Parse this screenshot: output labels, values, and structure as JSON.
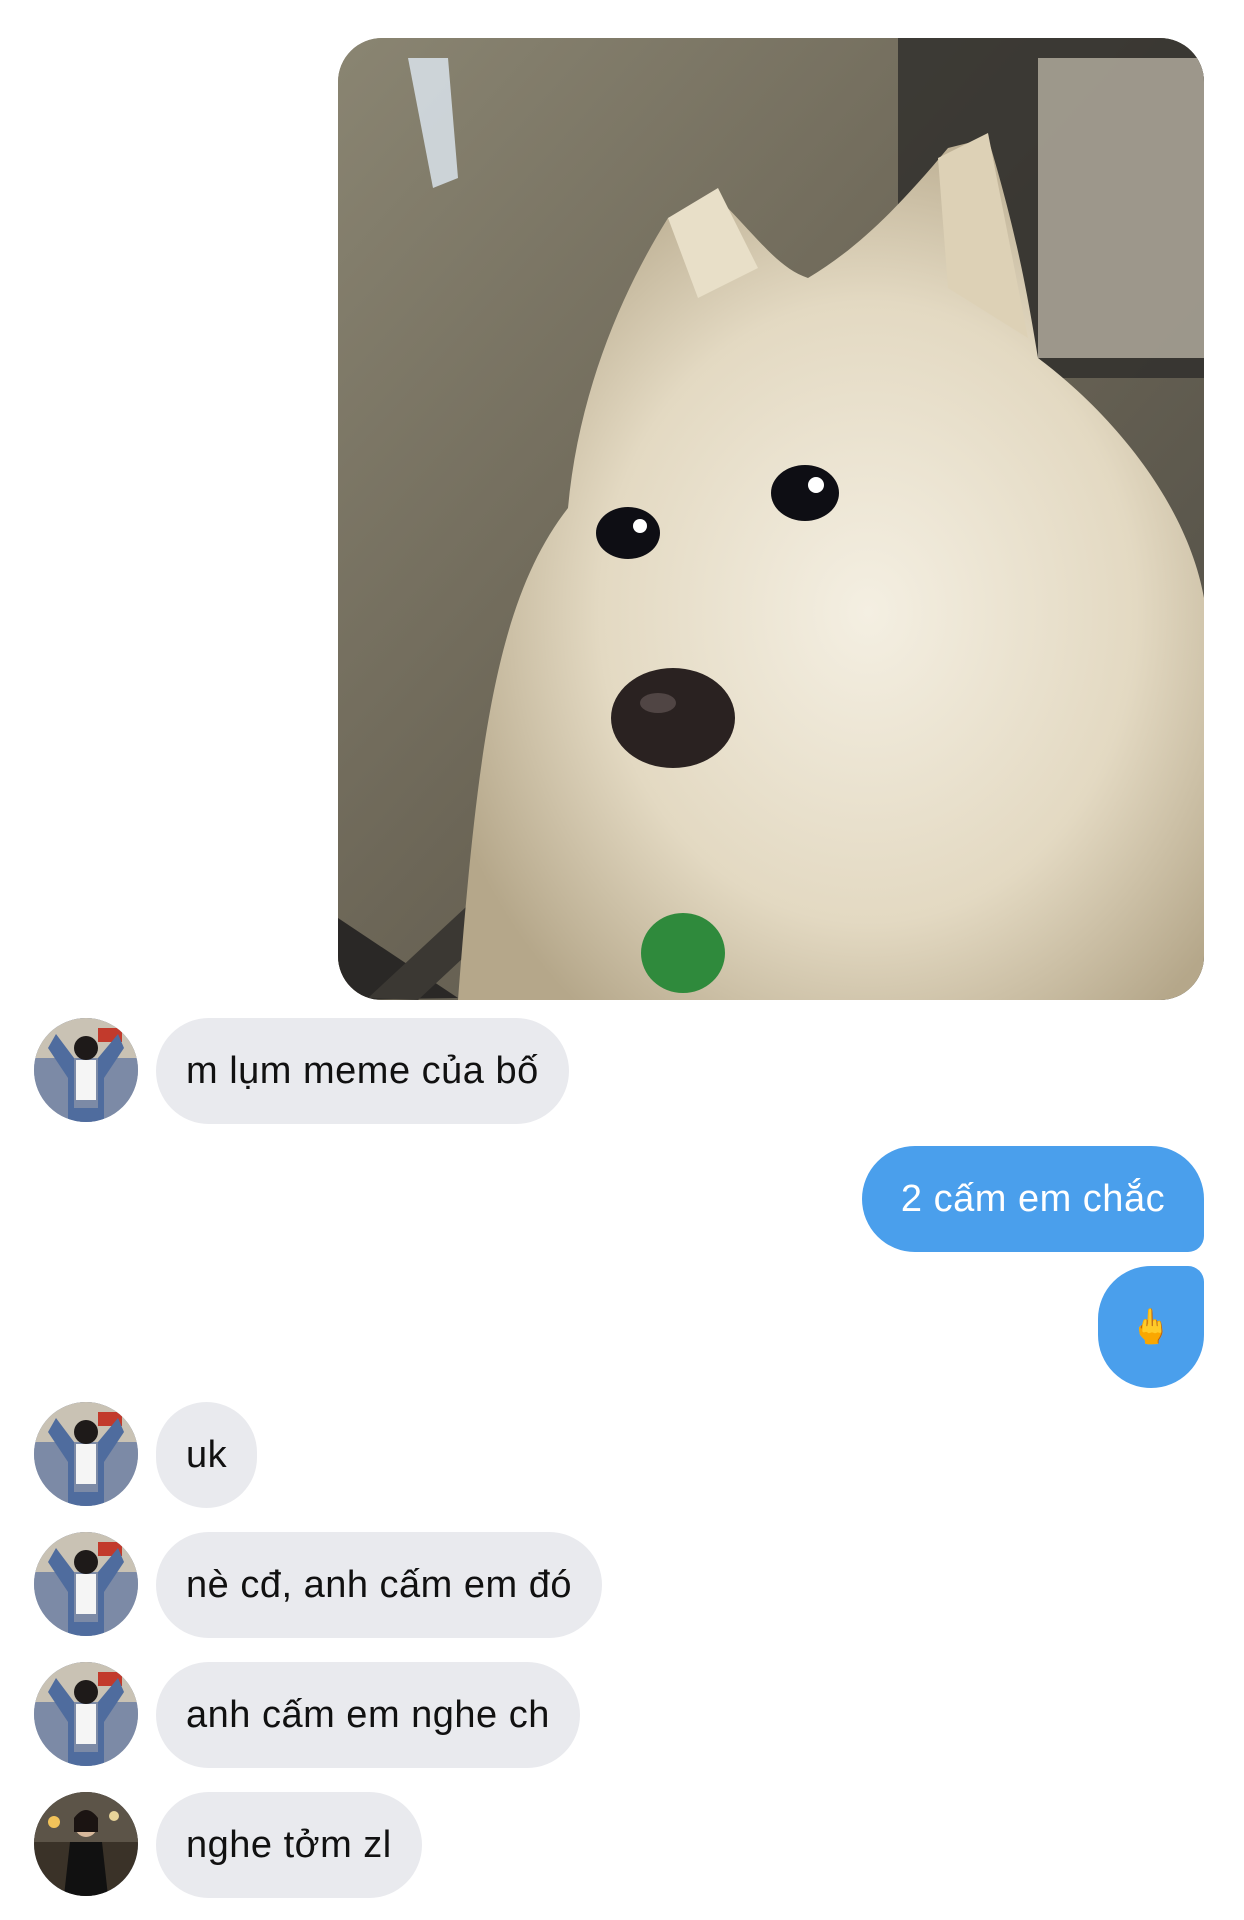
{
  "conversation": {
    "shared_image": {
      "icon": "dog-photo",
      "subject": "white fluffy dog"
    },
    "messages": [
      {
        "sender": "them",
        "avatar": "avatar-girl-denim-jacket",
        "text": "m lụm meme của bố"
      },
      {
        "sender": "me",
        "text": "2 cấm em chắc"
      },
      {
        "sender": "me",
        "text": "🖕"
      },
      {
        "sender": "them",
        "avatar": "avatar-girl-denim-jacket",
        "text": "uk"
      },
      {
        "sender": "them",
        "avatar": "avatar-girl-denim-jacket",
        "text": "nè cđ, anh cấm em đó"
      },
      {
        "sender": "them",
        "avatar": "avatar-girl-denim-jacket",
        "text": "anh cấm em nghe ch"
      },
      {
        "sender": "them",
        "avatar": "avatar-girl-dark-outfit",
        "text": "nghe tởm zl"
      }
    ]
  },
  "colors": {
    "outgoing_bubble": "#4a9fec",
    "incoming_bubble": "#e9eaee",
    "background": "#ffffff"
  }
}
